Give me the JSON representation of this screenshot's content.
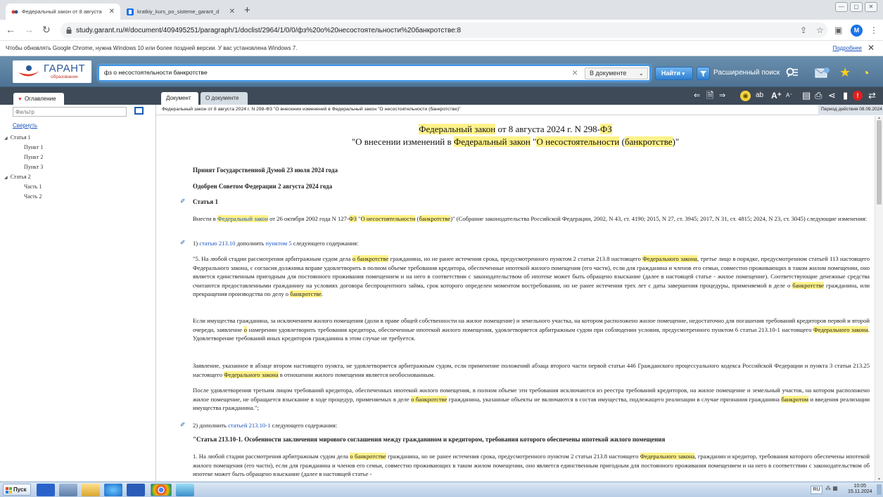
{
  "browser": {
    "tabs": [
      {
        "label": "Федеральный закон от 8 августа"
      },
      {
        "label": "kratkiy_kurs_po_sisteme_garant_d"
      }
    ],
    "url": "study.garant.ru/#/document/409495251/paragraph/1/doclist/2964/1/0/0/фз%20о%20несостоятельности%20банкротстве:8",
    "profile_initial": "M",
    "info_message": "Чтобы обновлять Google Chrome, нужна Windows 10 или более поздней версии. У вас установлена Windows 7.",
    "info_more": "Подробнее"
  },
  "garant": {
    "logo_name": "ГАРАНТ",
    "logo_sub": "образование",
    "search_query": "фз о несостоятельности банкротстве",
    "scope": "В документе",
    "find_label": "Найти",
    "advanced_label": "Расширенный поиск"
  },
  "sidebar": {
    "tab_label": "Оглавление",
    "filter_placeholder": "Фильтр",
    "collapse_label": "Свернуть",
    "items": [
      {
        "label": "Статья 1"
      },
      {
        "label": "Пункт 1"
      },
      {
        "label": "Пункт 2"
      },
      {
        "label": "Пункт 3"
      },
      {
        "label": "Статья 2"
      },
      {
        "label": "Часть 1"
      },
      {
        "label": "Часть 2"
      }
    ]
  },
  "doc_tabs": {
    "document": "Документ",
    "about": "О документе"
  },
  "breadcrumb": "Федеральный закон от 8 августа 2024 г. N 298-ФЗ \"О внесении изменений в Федеральный закон \"О несостоятельности (банкротстве)\"",
  "period": "Период действия 08.09.2024 - ?",
  "doc": {
    "title1": {
      "a": "Федеральный закон",
      "b": " от 8 августа 2024 г. N 298-",
      "c": "ФЗ"
    },
    "title2": {
      "a": "\"О внесении изменений в ",
      "b": "Федеральный закон",
      "c": " \"",
      "d": "О несостоятельности",
      "e": " (",
      "f": "банкротстве",
      "g": ")\""
    },
    "adopted": "Принят Государственной Думой 23 июля 2024 года",
    "approved": "Одобрен Советом Федерации 2 августа 2024 года",
    "article1": "Статья 1",
    "intro": {
      "s1": "Внести в ",
      "h1": "Федеральный закон",
      "s2": " от 26 октября 2002 года N 127-",
      "h2": "ФЗ",
      "s3": " \"",
      "h3": "О несостоятельности",
      "s4": " (",
      "h4": "банкротстве",
      "s5": ")\" (Собрание законодательства Российской Федерации, 2002, N 43, ст. 4190; 2015, N 27, ст. 3945; 2017, N 31, ст. 4815; 2024, N 23, ст. 3045) следующие изменения:"
    },
    "item1": {
      "s1": "1) ",
      "l1": "статью 213.10",
      "s2": " дополнить ",
      "l2": "пунктом 5",
      "s3": " следующего содержания:"
    },
    "para5": {
      "s1": "\"5. На любой стадии рассмотрения арбитражным судом дела ",
      "h1": "о банкротстве",
      "s2": " гражданина, но не ранее истечения срока, предусмотренного пунктом 2 статьи 213.8 настоящего ",
      "h2": "Федерального закона",
      "s3": ", третье лицо в порядке, предусмотренном статьей 113 настоящего Федерального закона, с согласия должника вправе удовлетворить в полном объеме требования кредитора, обеспеченные ипотекой жилого помещения (его части), если для гражданина и членов его семьи, совместно проживающих в таком жилом помещении, оно является единственным пригодным для постоянного проживания помещением и на него в соответствии с законодательством об ипотеке может быть обращено взыскание (далее в настоящей статье - жилое помещение). Соответствующие денежные средства считаются предоставленными гражданину на условиях договора беспроцентного займа, срок которого определен моментом востребования, но не ранее истечения трех лет с даты завершения процедуры, применяемой в деле о ",
      "h3": "банкротстве",
      "s4": " гражданина, или прекращения производства по делу о ",
      "h4": "банкротстве",
      "s5": "."
    },
    "para_b": {
      "s1": "Если имущества гражданина, за исключением жилого помещения (доли в праве общей собственности на жилое помещение) и земельного участка, на котором расположено жилое помещение, недостаточно для погашения требований кредиторов первой и второй очереди, заявление ",
      "h1": "о",
      "s2": " намерении удовлетворить требования кредитора, обеспеченные ипотекой жилого помещения, удовлетворяется арбитражным судом при соблюдении условия, предусмотренного пунктом 6 статьи 213.10-1 настоящего ",
      "h2": "Федерального закона",
      "s3": ". Удовлетворение требований иных кредиторов гражданина в этом случае не требуется."
    },
    "para_c": {
      "s1": "Заявление, указанное в абзаце втором настоящего пункта, не удовлетворяется арбитражным судом, если применение положений абзаца второго части первой статьи 446 Гражданского процессуального кодекса Российской Федерации и пункта 3 статьи 213.25 настоящего ",
      "h1": "Федерального закона",
      "s2": " в отношении жилого помещения является необоснованным."
    },
    "para_d": {
      "s1": "После удовлетворения третьим лицом требований кредитора, обеспеченных ипотекой жилого помещения, в полном объеме эти требования исключаются из реестра требований кредиторов, на жилое помещение и земельный участок, на котором расположено жилое помещение, не обращается взыскание в ходе процедур, применяемых в деле ",
      "h1": "о банкротстве",
      "s2": " гражданина, указанные объекты не включаются в состав имущества, подлежащего реализации в случае признания гражданина ",
      "h2": "банкротом",
      "s3": " и введения реализации имущества гражданина.\";"
    },
    "item2": {
      "s1": "2) дополнить ",
      "l1": "статьей 213.10-1",
      "s2": " следующего содержания:"
    },
    "heading2": "\"Статья 213.10-1. Особенности заключения мирового соглашения между гражданином и кредитором, требования которого обеспечены ипотекой жилого помещения",
    "para_e": {
      "s1": "1. На любой стадии рассмотрения арбитражным судом дела ",
      "h1": "о банкротстве",
      "s2": " гражданина, но не ранее истечения срока, предусмотренного пунктом 2 статьи 213.8 настоящего ",
      "h2": "Федерального закона",
      "s3": ", гражданин и кредитор, требования которого обеспечены ипотекой жилого помещения (его части), если для гражданина и членов его семьи, совместно проживающих в таком жилом помещении, оно является единственным пригодным для постоянного проживания помещением и на него в соответствии с законодательством об ипотеке может быть обращено взыскание (далее в настоящей статье -"
    }
  },
  "taskbar": {
    "start_label": "Пуск",
    "lang": "RU",
    "time": "10:05",
    "date": "15.11.2024"
  }
}
